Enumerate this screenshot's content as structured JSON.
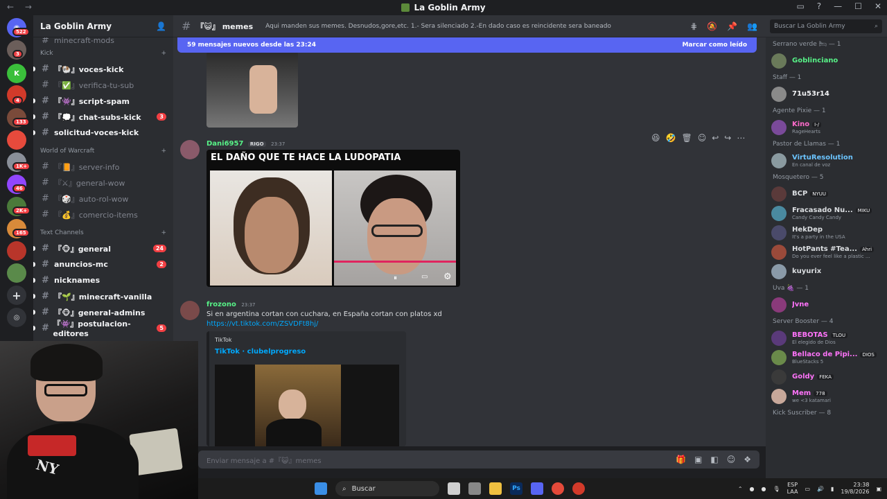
{
  "window": {
    "title": "La Goblin Army",
    "nav": "← →"
  },
  "server": {
    "name": "La Goblin Army",
    "top_item": "minecraft-mods"
  },
  "rail_badges": [
    "522",
    "3",
    "4",
    "133",
    "1K+",
    "46",
    "2K+",
    "165"
  ],
  "categories": {
    "kick": "Kick",
    "wow": "World of Warcraft",
    "text": "Text Channels"
  },
  "channels_kick": [
    {
      "label": "『🐏』voces-kick",
      "unread": true,
      "badge": ""
    },
    {
      "label": "『✅』verifica-tu-sub",
      "unread": false,
      "badge": ""
    },
    {
      "label": "『👾』script-spam",
      "unread": true,
      "badge": ""
    },
    {
      "label": "『💭』chat-subs-kick",
      "unread": true,
      "badge": "3"
    },
    {
      "label": "solicitud-voces-kick",
      "unread": true,
      "badge": ""
    }
  ],
  "channels_wow": [
    {
      "label": "『📙』server-info"
    },
    {
      "label": "『⚔』general-wow"
    },
    {
      "label": "『🎲』auto-rol-wow"
    },
    {
      "label": "『💰』comercio-items"
    }
  ],
  "channels_text": [
    {
      "label": "『🐵』general",
      "badge": "24"
    },
    {
      "label": "anuncios-mc",
      "badge": "2"
    },
    {
      "label": "nicknames",
      "badge": ""
    },
    {
      "label": "『🌱』minecraft-vanilla",
      "badge": ""
    },
    {
      "label": "『🐵』general-admins",
      "badge": ""
    },
    {
      "label": "『👾』postulacion-editores",
      "badge": "5"
    }
  ],
  "channel_header": {
    "name": "memes",
    "prefix": "『😺』",
    "topic": "Aqui manden sus memes. Desnudos,gore,etc. 1.- Sera silenciado 2.-En dado caso es reincidente sera baneado"
  },
  "search": {
    "placeholder": "Buscar La Goblin Army"
  },
  "new_messages": {
    "text": "59 mensajes nuevos desde las 23:24",
    "action": "Marcar como leído"
  },
  "messages": [
    {
      "author": "Dani6957",
      "tag": "RIGO",
      "time": "23:37",
      "meme_caption": "EL DAÑO QUE TE HACE LA LUDOPATIA"
    },
    {
      "author": "frozono",
      "time": "23:37",
      "text": "Si en argentina cortan con cuchara, en España cortan con platos xd",
      "link": "https://vt.tiktok.com/ZSVDFt8hj/",
      "embed_provider": "TikTok",
      "embed_title": "TikTok · clubelprogreso"
    }
  ],
  "composer": {
    "placeholder": "Enviar mensaje a #『😺』memes"
  },
  "members": [
    {
      "group": "Serrano verde 🛏 — 1",
      "list": [
        {
          "name": "Goblinciano",
          "color": "#57f287",
          "sub": "",
          "tag": ""
        }
      ]
    },
    {
      "group": "Staff — 1",
      "list": [
        {
          "name": "71u53r14",
          "color": "#f2f3f5",
          "sub": "",
          "tag": ""
        }
      ]
    },
    {
      "group": "Agente Pixie — 1",
      "list": [
        {
          "name": "Kino",
          "color": "#ff6bcb",
          "sub": "RageHearts",
          "tag": "I-/"
        }
      ]
    },
    {
      "group": "Pastor de Llamas — 1",
      "list": [
        {
          "name": "VirtuResolution",
          "color": "#6bc4ff",
          "sub": "En canal de voz",
          "tag": ""
        }
      ]
    },
    {
      "group": "Mosquetero — 5",
      "list": [
        {
          "name": "BCP",
          "color": "#dbdee1",
          "sub": "",
          "tag": "NYUU"
        },
        {
          "name": "Fracasado Nu...",
          "color": "#dbdee1",
          "sub": "Candy Candy Candy",
          "tag": "MIKU"
        },
        {
          "name": "HekDep",
          "color": "#dbdee1",
          "sub": "It's a party in the USA",
          "tag": ""
        },
        {
          "name": "HotPants #Tea...",
          "color": "#dbdee1",
          "sub": "Do you ever feel like a plastic ...",
          "tag": "Ahri"
        },
        {
          "name": "kuyurix",
          "color": "#dbdee1",
          "sub": "",
          "tag": ""
        }
      ]
    },
    {
      "group": "Uva 🍇 — 1",
      "list": [
        {
          "name": "Jvne",
          "color": "#ff73fa",
          "sub": "",
          "tag": ""
        }
      ]
    },
    {
      "group": "Server Booster — 4",
      "list": [
        {
          "name": "BEBOTAS",
          "color": "#ff73fa",
          "sub": "El elegido de Dios",
          "tag": "TLOU"
        },
        {
          "name": "Bellaco de Pipi...",
          "color": "#ff73fa",
          "sub": "BlueStacks 5",
          "tag": "DIOS"
        },
        {
          "name": "Goldy",
          "color": "#ff73fa",
          "sub": "",
          "tag": "FEKA"
        },
        {
          "name": "Mem",
          "color": "#ff73fa",
          "sub": "we <3 katamari",
          "tag": "778"
        }
      ]
    },
    {
      "group": "Kick Suscriber — 8",
      "list": []
    }
  ],
  "taskbar": {
    "search": "Buscar",
    "lang": "ESP",
    "lang2": "LAA",
    "time": "23:38",
    "date": "19/8/2026"
  }
}
